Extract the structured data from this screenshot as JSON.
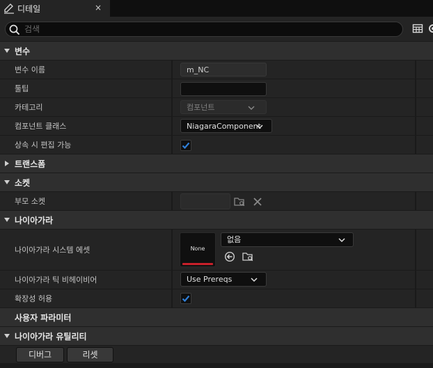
{
  "tab": {
    "title": "디테일",
    "close": "×",
    "icon": "pencil-icon"
  },
  "search": {
    "placeholder": "검색"
  },
  "toolbar": {
    "icons": [
      "table-icon",
      "gear-icon"
    ]
  },
  "categories": {
    "variable": "변수",
    "transform": "트랜스폼",
    "socket": "소켓",
    "niagara": "나이아가라",
    "user_params": "사용자 파라미터",
    "niagara_utils": "나이아가라 유틸리티"
  },
  "rows": {
    "var_name": {
      "label": "변수 이름",
      "value": "m_NC"
    },
    "tooltip": {
      "label": "툴팁",
      "value": ""
    },
    "category": {
      "label": "카테고리",
      "value": "컴포넌트"
    },
    "component_class": {
      "label": "컴포넌트 클래스",
      "value": "NiagaraComponent"
    },
    "editable_inherit": {
      "label": "상속 시 편집 가능",
      "checked": true
    },
    "parent_socket": {
      "label": "부모 소켓",
      "value": ""
    },
    "system_asset": {
      "label": "나이아가라 시스템 에셋",
      "thumb": "None",
      "value": "없음"
    },
    "tick_behavior": {
      "label": "나이아가라 틱 비헤이비어",
      "value": "Use Prereqs"
    },
    "allow_scalability": {
      "label": "확장성 허용",
      "checked": true
    }
  },
  "buttons": {
    "debug": "디버그",
    "reset": "리셋"
  },
  "colors": {
    "accent_check": "#2f7fd8",
    "thumb_bar": "#c8202a"
  }
}
